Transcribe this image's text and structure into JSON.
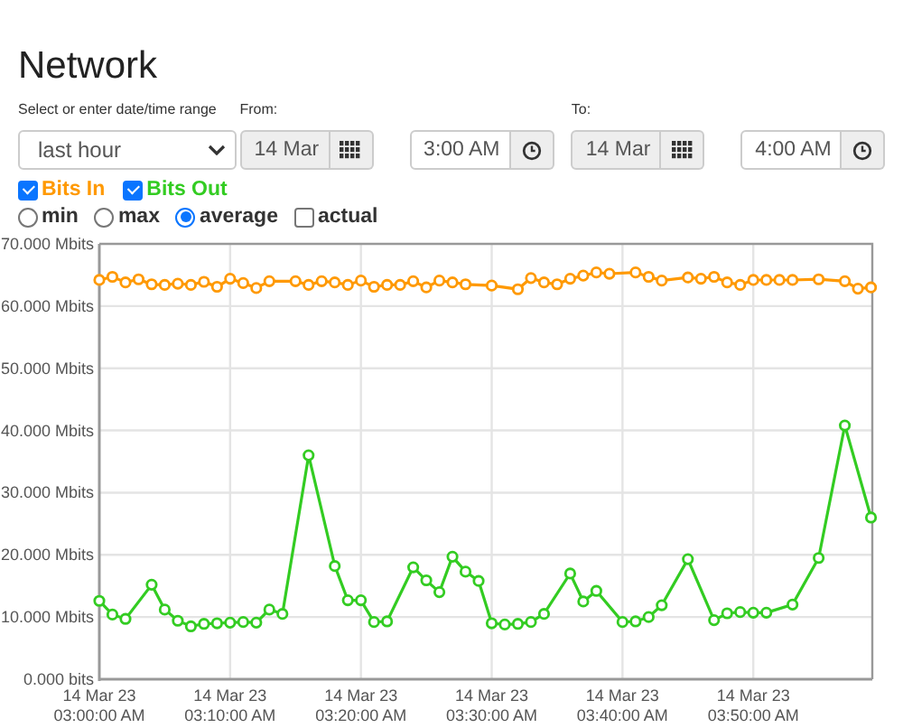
{
  "title": "Network",
  "range": {
    "label": "Select or enter date/time range",
    "value": "last hour"
  },
  "from": {
    "label": "From:",
    "date": "14 Mar",
    "time": "3:00 AM"
  },
  "to": {
    "label": "To:",
    "date": "14 Mar",
    "time": "4:00 AM"
  },
  "series_toggles": [
    {
      "checked": true
    },
    {
      "checked": true
    }
  ],
  "options": [
    {
      "kind": "radio",
      "label": "min",
      "selected": false
    },
    {
      "kind": "radio",
      "label": "max",
      "selected": false
    },
    {
      "kind": "radio",
      "label": "average",
      "selected": true
    },
    {
      "kind": "checkbox",
      "label": "actual",
      "checked": false
    }
  ],
  "chart_data": {
    "type": "line",
    "categories": [
      "14 Mar 23\n03:00:00 AM",
      null,
      null,
      null,
      null,
      null,
      null,
      null,
      null,
      null,
      "14 Mar 23\n03:10:00 AM",
      null,
      null,
      null,
      null,
      null,
      null,
      null,
      null,
      null,
      "14 Mar 23\n03:20:00 AM",
      null,
      null,
      null,
      null,
      null,
      null,
      null,
      null,
      null,
      "14 Mar 23\n03:30:00 AM",
      null,
      null,
      null,
      null,
      null,
      null,
      null,
      null,
      null,
      "14 Mar 23\n03:40:00 AM",
      null,
      null,
      null,
      null,
      null,
      null,
      null,
      null,
      null,
      "14 Mar 23\n03:50:00 AM",
      null,
      null,
      null,
      null,
      null,
      null,
      null,
      null,
      null
    ],
    "series": [
      {
        "name": "Bits In",
        "color": "#ff9900",
        "marker": "circle",
        "values": [
          64.2,
          64.7,
          63.8,
          64.3,
          63.5,
          63.4,
          63.6,
          63.4,
          63.9,
          63.1,
          64.4,
          63.7,
          62.9,
          64.0,
          null,
          64.0,
          63.4,
          64.0,
          63.8,
          63.4,
          64.1,
          63.1,
          63.4,
          63.4,
          64.0,
          63.0,
          64.1,
          63.8,
          63.5,
          null,
          63.3,
          null,
          62.7,
          64.5,
          63.8,
          63.5,
          64.4,
          64.9,
          65.4,
          65.2,
          null,
          65.4,
          64.7,
          64.1,
          null,
          64.6,
          64.4,
          64.7,
          63.8,
          63.4,
          64.2,
          64.2,
          64.2,
          64.2,
          null,
          64.3,
          null,
          64.0,
          62.8,
          63.0
        ]
      },
      {
        "name": "Bits Out",
        "color": "#33cc22",
        "marker": "circle",
        "values": [
          12.6,
          10.4,
          9.7,
          null,
          15.2,
          11.2,
          9.4,
          8.5,
          8.9,
          9.0,
          9.1,
          9.2,
          9.1,
          11.2,
          10.5,
          null,
          36.0,
          null,
          18.2,
          12.7,
          12.7,
          9.2,
          9.3,
          null,
          18.0,
          15.9,
          14.0,
          19.7,
          17.3,
          15.8,
          9.0,
          8.8,
          8.9,
          9.2,
          10.5,
          null,
          17.0,
          12.5,
          14.2,
          null,
          9.2,
          9.3,
          10.0,
          11.9,
          null,
          19.3,
          null,
          9.5,
          10.6,
          10.8,
          10.7,
          10.7,
          null,
          12.0,
          null,
          19.5,
          null,
          40.8,
          null,
          26.0
        ]
      }
    ],
    "grid": true,
    "ylim": [
      0,
      70
    ],
    "yticks": [
      {
        "value": 0,
        "label": "0.000 bits"
      },
      {
        "value": 10,
        "label": "10.000 Mbits"
      },
      {
        "value": 20,
        "label": "20.000 Mbits"
      },
      {
        "value": 30,
        "label": "30.000 Mbits"
      },
      {
        "value": 40,
        "label": "40.000 Mbits"
      },
      {
        "value": 50,
        "label": "50.000 Mbits"
      },
      {
        "value": 60,
        "label": "60.000 Mbits"
      },
      {
        "value": 70,
        "label": "70.000 Mbits"
      }
    ]
  }
}
